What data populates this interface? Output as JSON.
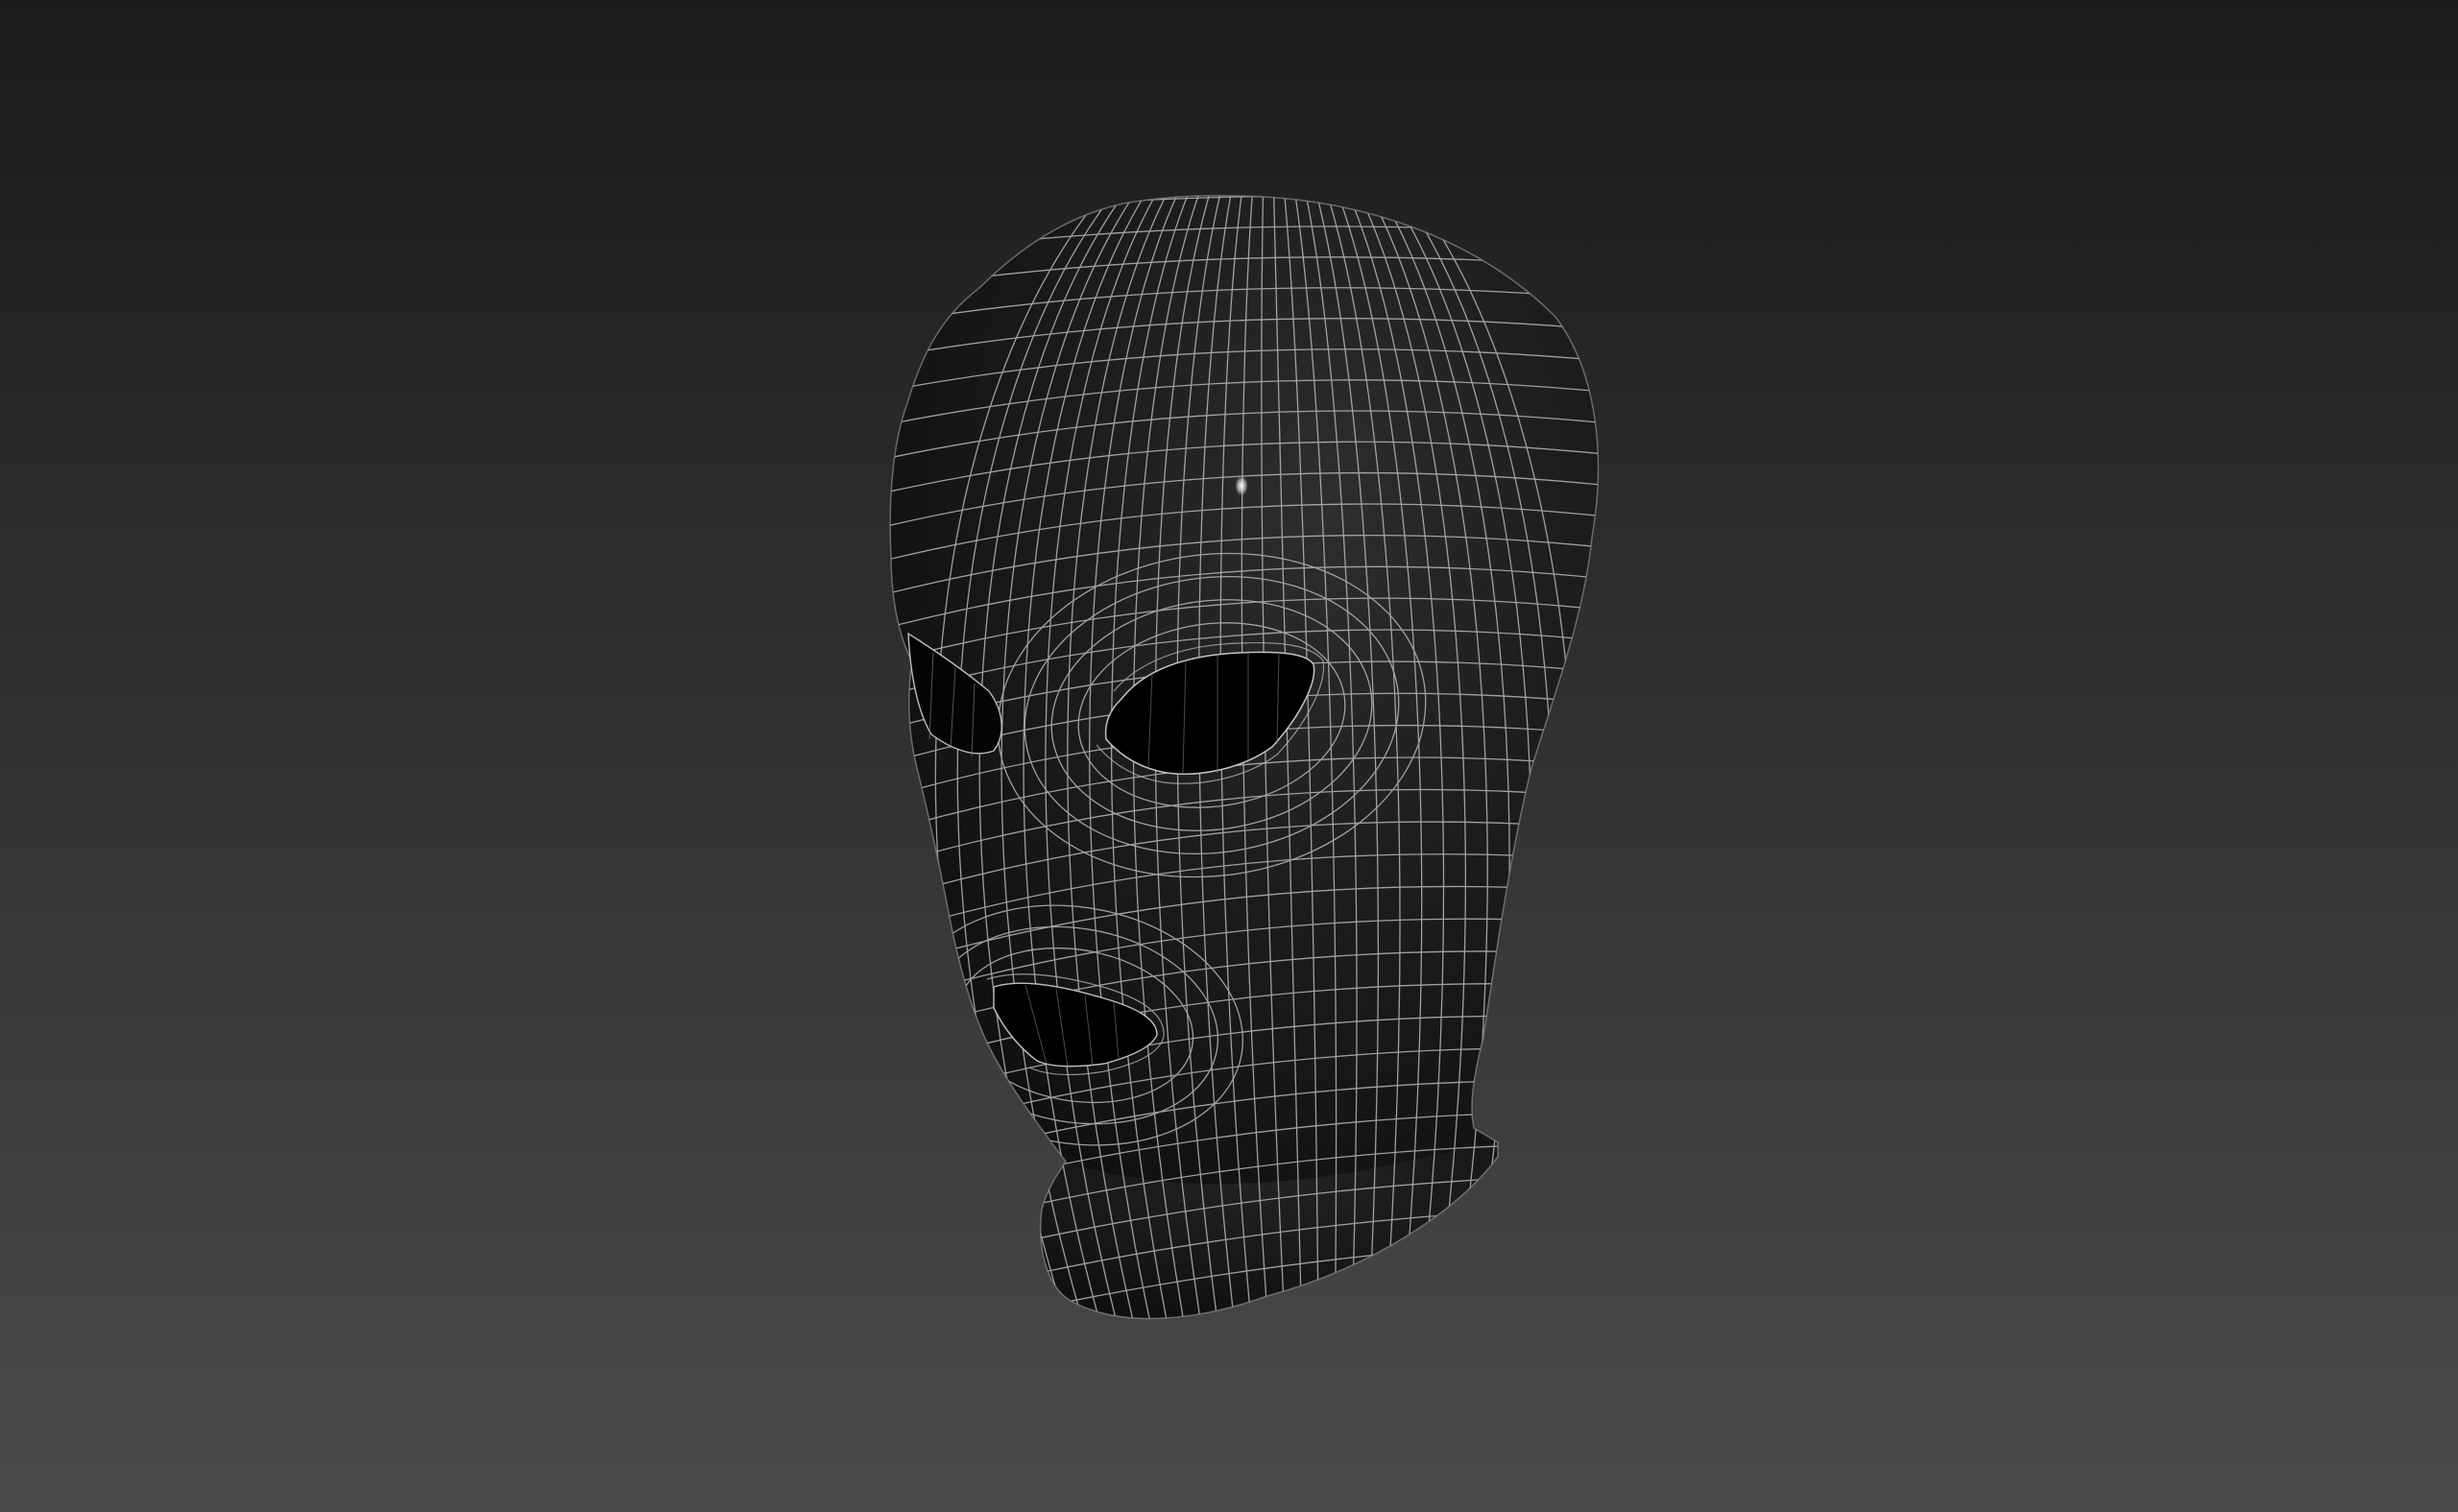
{
  "viewport": {
    "background_top_color": "#1b1b1b",
    "background_bottom_color": "#4a4a4a",
    "model": {
      "object": "balaclava-head-mesh",
      "shading": "dark-smooth-with-wireframe",
      "base_color": "#141414",
      "highlight_color": "#3a3a3a",
      "wireframe_color": "#b8b8b8",
      "specular_color": "#ffffff"
    }
  }
}
